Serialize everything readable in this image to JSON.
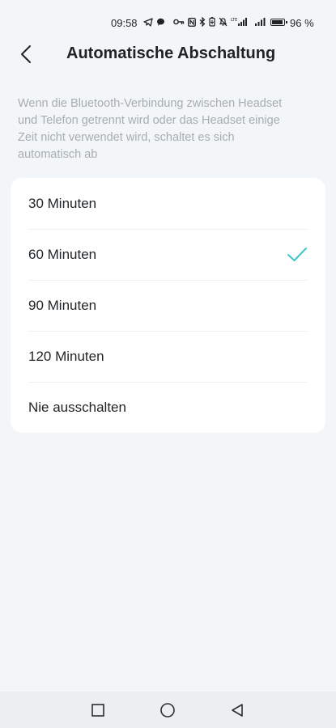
{
  "status_bar": {
    "time": "09:58",
    "battery_text": "96 %",
    "battery_level": 0.96,
    "left_icons": [
      "telegram-icon",
      "chat-bubble-icon"
    ],
    "right_icons": [
      "key-icon",
      "nfc-icon",
      "bluetooth-icon",
      "battery-saver-icon",
      "mute-icon",
      "lte-signal-icon",
      "signal-icon",
      "battery-icon"
    ]
  },
  "header": {
    "title": "Automatische Abschaltung",
    "back_icon": "chevron-left-icon"
  },
  "description": "Wenn die Bluetooth-Verbindung zwischen Headset und Telefon getrennt wird oder das Headset einige Zeit nicht verwendet wird, schaltet es sich automatisch ab",
  "options": [
    {
      "label": "30 Minuten",
      "selected": false
    },
    {
      "label": "60 Minuten",
      "selected": true
    },
    {
      "label": "90 Minuten",
      "selected": false
    },
    {
      "label": "120 Minuten",
      "selected": false
    },
    {
      "label": "Nie ausschalten",
      "selected": false
    }
  ],
  "accent_color": "#3fc3cc",
  "nav_bar": {
    "buttons": [
      "recent-apps-icon",
      "home-icon",
      "back-triangle-icon"
    ]
  }
}
